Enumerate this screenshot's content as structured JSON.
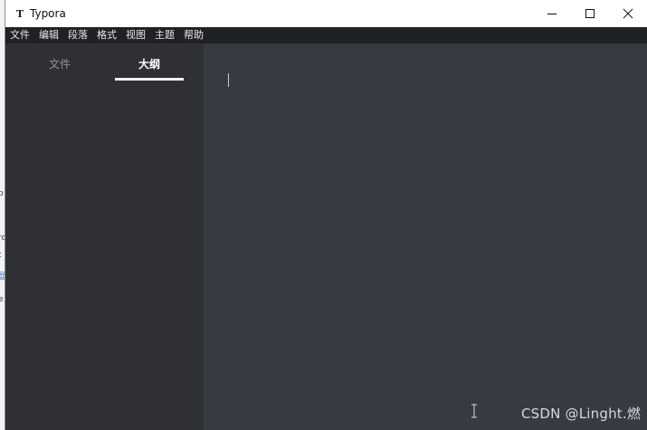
{
  "background_window": {
    "fragments": [
      "p",
      "rc",
      "t",
      "显",
      "e"
    ]
  },
  "window": {
    "icon": "T",
    "title": "Typora",
    "controls": [
      "minimize-icon",
      "maximize-icon",
      "close-icon"
    ]
  },
  "menubar": {
    "items": [
      "文件",
      "编辑",
      "段落",
      "格式",
      "视图",
      "主题",
      "帮助"
    ]
  },
  "sidebar": {
    "tabs": [
      {
        "label": "文件",
        "active": false
      },
      {
        "label": "大纲",
        "active": true
      }
    ]
  },
  "editor": {
    "cursor_icon": "text-cursor-icon",
    "watermark": "CSDN @Linght.燃"
  },
  "colors": {
    "editor_bg": "#363b43",
    "sidebar_bg": "#2e3034",
    "menubar_bg": "#1f2125",
    "titlebar_bg": "#ffffff"
  }
}
